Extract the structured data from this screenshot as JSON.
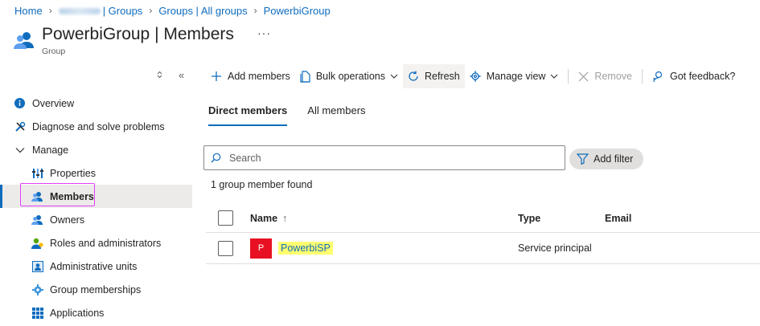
{
  "breadcrumb": {
    "home": "Home",
    "tenant_groups": "| Groups",
    "all_groups": "Groups | All groups",
    "current": "PowerbiGroup"
  },
  "header": {
    "title": "PowerbiGroup | Members",
    "subtitle": "Group",
    "more": "···"
  },
  "sidebar": {
    "items": [
      {
        "label": "Overview",
        "icon": "info-icon"
      },
      {
        "label": "Diagnose and solve problems",
        "icon": "wrench-icon"
      },
      {
        "label": "Manage",
        "icon": "chevron-down-icon"
      },
      {
        "label": "Properties",
        "icon": "properties-icon"
      },
      {
        "label": "Members",
        "icon": "members-icon",
        "active": true
      },
      {
        "label": "Owners",
        "icon": "owners-icon"
      },
      {
        "label": "Roles and administrators",
        "icon": "roles-icon"
      },
      {
        "label": "Administrative units",
        "icon": "admin-units-icon"
      },
      {
        "label": "Group memberships",
        "icon": "gear-icon"
      },
      {
        "label": "Applications",
        "icon": "grid-icon"
      }
    ]
  },
  "toolbar": {
    "add_members": "Add members",
    "bulk_operations": "Bulk operations",
    "refresh": "Refresh",
    "manage_view": "Manage view",
    "remove": "Remove",
    "got_feedback": "Got feedback?"
  },
  "tabs": {
    "direct": "Direct members",
    "all": "All members"
  },
  "search": {
    "placeholder": "Search"
  },
  "filter": {
    "label": "Add filter"
  },
  "results": {
    "count_text": "1 group member found"
  },
  "table": {
    "headers": {
      "name": "Name",
      "sort": "↑",
      "type": "Type",
      "email": "Email"
    },
    "rows": [
      {
        "avatar": "P",
        "name": "PowerbiSP",
        "type": "Service principal",
        "email": ""
      }
    ]
  },
  "colors": {
    "accent": "#0f6cbd",
    "avatar_red": "#e81123",
    "highlight_yellow": "#ffff70",
    "annotation_magenta": "#e040fb"
  }
}
